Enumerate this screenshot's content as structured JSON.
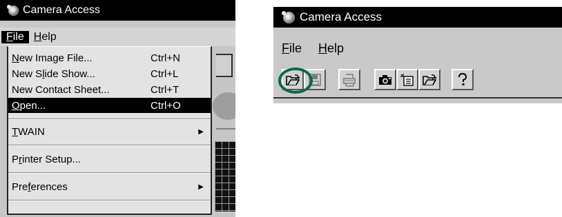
{
  "left_window": {
    "title": "Camera Access",
    "menu": {
      "file": "File",
      "help": "Help"
    },
    "file_menu": [
      {
        "label": "New Image File...",
        "shortcut": "Ctrl+N"
      },
      {
        "label": "New Slide Show...",
        "shortcut": "Ctrl+L"
      },
      {
        "label": "New Contact Sheet...",
        "shortcut": "Ctrl+T"
      },
      {
        "label": "Open...",
        "shortcut": "Ctrl+O",
        "selected": true
      },
      {
        "label": "TWAIN",
        "submenu": true
      },
      {
        "label": "Printer Setup..."
      },
      {
        "label": "Preferences",
        "submenu": true
      }
    ]
  },
  "right_window": {
    "title": "Camera Access",
    "menu": {
      "file": "File",
      "help": "Help"
    },
    "toolbar": [
      {
        "icon": "open-folder-icon",
        "highlighted": true
      },
      {
        "icon": "save-disk-icon",
        "disabled": true
      },
      {
        "icon": "print-icon",
        "disabled": true
      },
      {
        "icon": "camera-icon"
      },
      {
        "icon": "contact-sheet-icon"
      },
      {
        "icon": "open-folder-icon"
      },
      {
        "icon": "help-question-icon"
      }
    ],
    "highlight_color": "#0a6b3a"
  }
}
